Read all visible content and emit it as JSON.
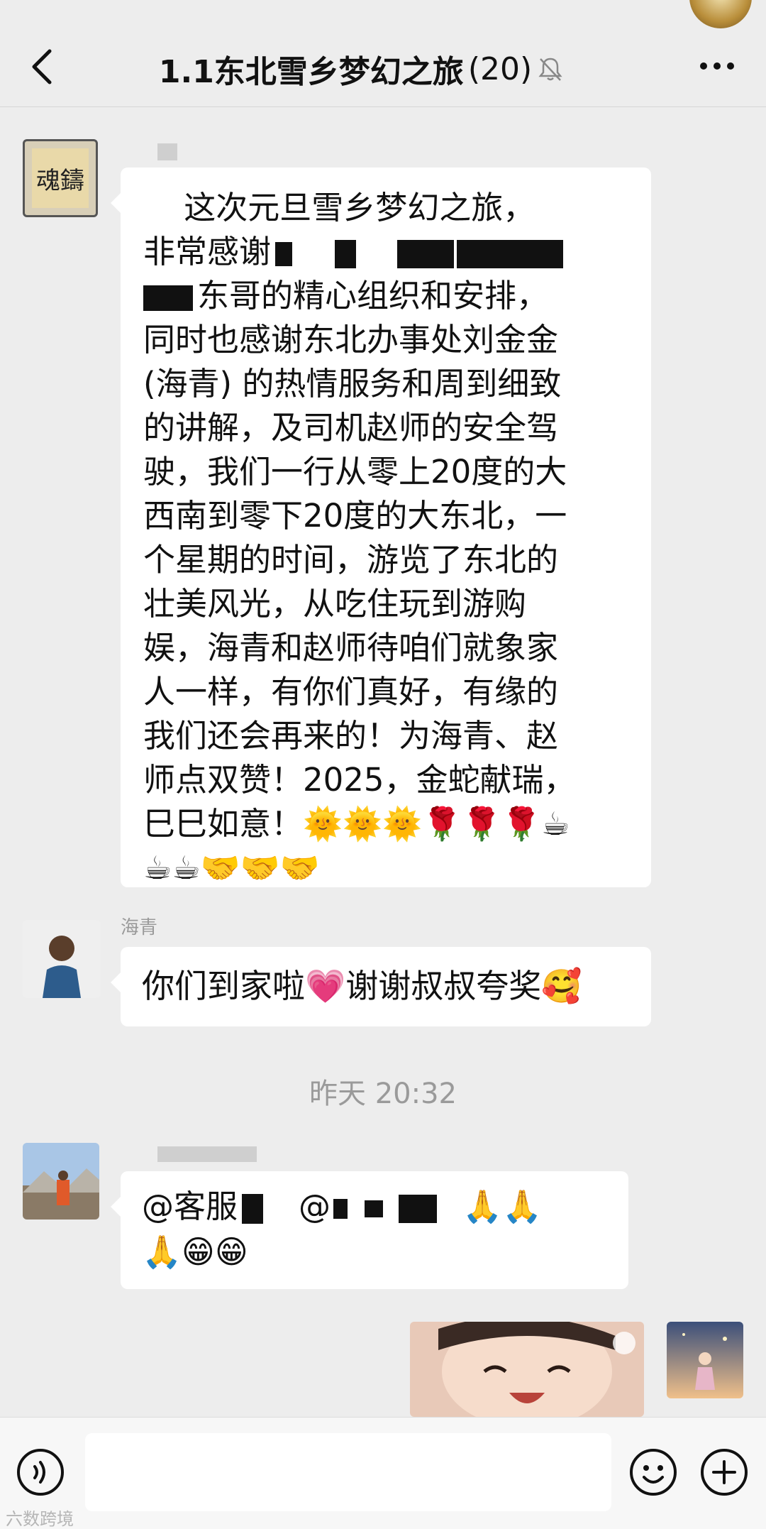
{
  "header": {
    "title": "1.1东北雪乡梦幻之旅",
    "member_count": "(20)",
    "back_icon": "chevron-left-icon",
    "mute_icon": "bell-muted-icon",
    "more_icon": "more-icon"
  },
  "messages": [
    {
      "avatar_text": "魂鑄",
      "lines": [
        "    这次元旦雪乡梦幻之旅，",
        "非常感谢",
        "东哥的精心组织和安排，",
        "同时也感谢东北办事处刘金金",
        "(海青) 的热情服务和周到细致",
        "的讲解，及司机赵师的安全驾",
        "驶，我们一行从零上20度的大",
        "西南到零下20度的大东北，一",
        "个星期的时间，游览了东北的",
        "壮美风光，从吃住玩到游购",
        "娱，海青和赵师待咱们就象家",
        "人一样，有你们真好，有缘的",
        "我们还会再来的！为海青、赵",
        "师点双赞！2025，金蛇献瑞，",
        "巳巳如意！🌞🌞🌞🌹🌹🌹☕",
        "☕☕🤝🤝🤝"
      ]
    },
    {
      "sender": "海青",
      "text": "你们到家啦💗谢谢叔叔夸奖🥰"
    },
    {
      "line1_a": "@客服",
      "line1_b": "@",
      "line1_emoji": "🙏🙏",
      "line2": "🙏😁😁"
    }
  ],
  "timestamp": "昨天 20:32",
  "footer": {
    "watermark": "六数跨境"
  }
}
